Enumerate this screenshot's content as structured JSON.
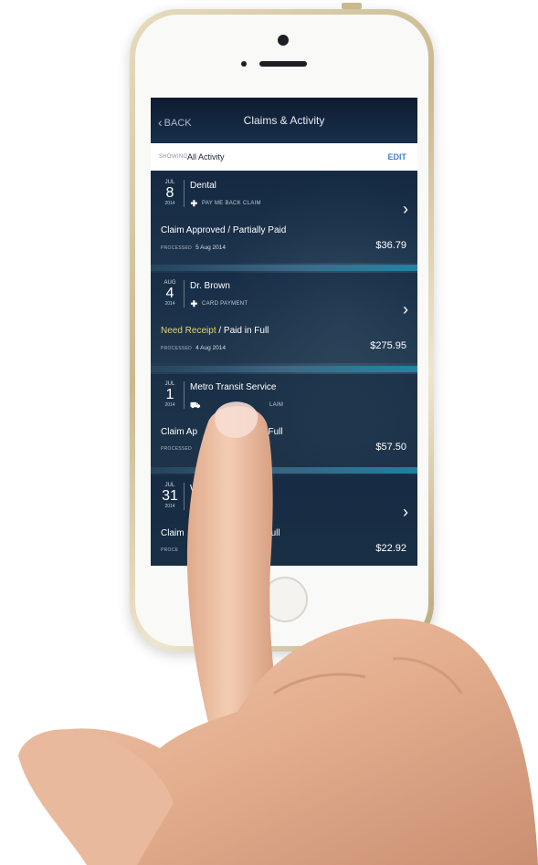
{
  "nav": {
    "back_label": "BACK",
    "title": "Claims & Activity"
  },
  "filter": {
    "showing_label": "SHOWING:",
    "showing_value": "All Activity",
    "edit_label": "EDIT"
  },
  "activities": [
    {
      "month": "JUL",
      "day": "8",
      "year": "2014",
      "merchant": "Dental",
      "type_icon": "plus-icon",
      "type": "PAY ME BACK CLAIM",
      "status_highlight": "",
      "status": "Claim Approved / Partially Paid",
      "processed_label": "PROCESSED",
      "processed_date": "5 Aug 2014",
      "amount": "$36.79"
    },
    {
      "month": "AUG",
      "day": "4",
      "year": "2014",
      "merchant": "Dr. Brown",
      "type_icon": "plus-icon",
      "type": "CARD PAYMENT",
      "status_highlight": "Need Receipt",
      "status": " / Paid in Full",
      "processed_label": "PROCESSED",
      "processed_date": "4 Aug 2014",
      "amount": "$275.95"
    },
    {
      "month": "JUL",
      "day": "1",
      "year": "2014",
      "merchant": "Metro Transit Service",
      "type_icon": "car-icon",
      "type": "LAIM",
      "status_highlight": "",
      "status": "Claim Ap",
      "status_tail": "d In Full",
      "processed_label": "PROCESSED",
      "processed_date": "",
      "amount": "$57.50"
    },
    {
      "month": "JUL",
      "day": "31",
      "year": "2014",
      "merchant": "W",
      "merchant_tail": "s",
      "type_icon": "plus-icon",
      "type": "",
      "status_highlight": "",
      "status": "Claim",
      "status_tail": "d in Full",
      "processed_label": "PROCE",
      "processed_date": "",
      "amount": "$22.92"
    }
  ]
}
